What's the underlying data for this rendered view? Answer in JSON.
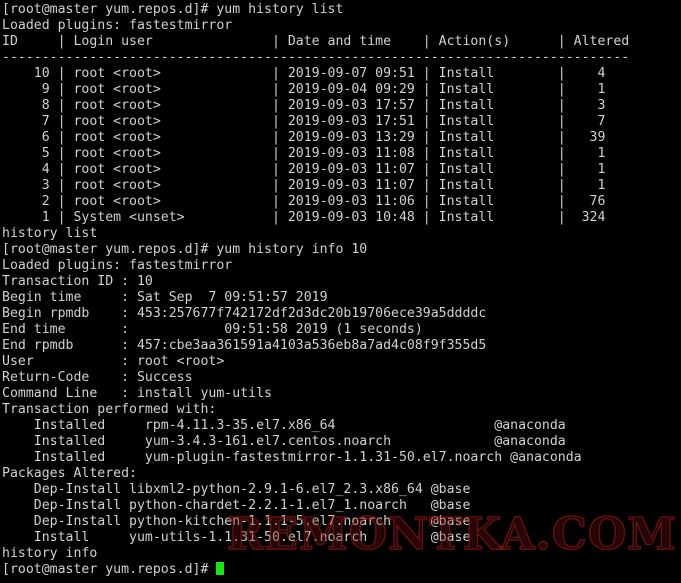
{
  "terminal": {
    "background_color": "#000000",
    "text_color": "#cfd2cd",
    "cursor_color": "#12e712",
    "watermark_color": "#961a1a",
    "watermark": "REMONTKA.COM",
    "prompt": "[root@master yum.repos.d]#",
    "lines": [
      "[root@master yum.repos.d]# yum history list",
      "Loaded plugins: fastestmirror",
      "ID     | Login user               | Date and time    | Action(s)      | Altered",
      "-------------------------------------------------------------------------------",
      "    10 | root <root>              | 2019-09-07 09:51 | Install        |    4",
      "     9 | root <root>              | 2019-09-04 09:29 | Install        |    1",
      "     8 | root <root>              | 2019-09-03 17:57 | Install        |    3",
      "     7 | root <root>              | 2019-09-03 17:51 | Install        |    7",
      "     6 | root <root>              | 2019-09-03 13:29 | Install        |   39",
      "     5 | root <root>              | 2019-09-03 11:08 | Install        |    1",
      "     4 | root <root>              | 2019-09-03 11:07 | Install        |    1",
      "     3 | root <root>              | 2019-09-03 11:07 | Install        |    1",
      "     2 | root <root>              | 2019-09-03 11:06 | Install        |   76",
      "     1 | System <unset>           | 2019-09-03 10:48 | Install        |  324",
      "history list",
      "[root@master yum.repos.d]# yum history info 10",
      "Loaded plugins: fastestmirror",
      "Transaction ID : 10",
      "Begin time     : Sat Sep  7 09:51:57 2019",
      "Begin rpmdb    : 453:257677f742172df2d3dc20b19706ece39a5ddddc",
      "End time       :            09:51:58 2019 (1 seconds)",
      "End rpmdb      : 457:cbe3aa361591a4103a536eb8a7ad4c08f9f355d5",
      "User           : root <root>",
      "Return-Code    : Success",
      "Command Line   : install yum-utils",
      "Transaction performed with:",
      "    Installed     rpm-4.11.3-35.el7.x86_64                    @anaconda",
      "    Installed     yum-3.4.3-161.el7.centos.noarch             @anaconda",
      "    Installed     yum-plugin-fastestmirror-1.1.31-50.el7.noarch @anaconda",
      "Packages Altered:",
      "    Dep-Install libxml2-python-2.9.1-6.el7_2.3.x86_64 @base",
      "    Dep-Install python-chardet-2.2.1-1.el7_1.noarch   @base",
      "    Dep-Install python-kitchen-1.1.1-5.el7.noarch     @base",
      "    Install     yum-utils-1.1.31-50.el7.noarch        @base",
      "history info",
      "[root@master yum.repos.d]# "
    ],
    "history_table": {
      "columns": [
        "ID",
        "Login user",
        "Date and time",
        "Action(s)",
        "Altered"
      ],
      "rows": [
        {
          "id": "10",
          "login_user": "root <root>",
          "datetime": "2019-09-07 09:51",
          "action": "Install",
          "altered": "4"
        },
        {
          "id": "9",
          "login_user": "root <root>",
          "datetime": "2019-09-04 09:29",
          "action": "Install",
          "altered": "1"
        },
        {
          "id": "8",
          "login_user": "root <root>",
          "datetime": "2019-09-03 17:57",
          "action": "Install",
          "altered": "3"
        },
        {
          "id": "7",
          "login_user": "root <root>",
          "datetime": "2019-09-03 17:51",
          "action": "Install",
          "altered": "7"
        },
        {
          "id": "6",
          "login_user": "root <root>",
          "datetime": "2019-09-03 13:29",
          "action": "Install",
          "altered": "39"
        },
        {
          "id": "5",
          "login_user": "root <root>",
          "datetime": "2019-09-03 11:08",
          "action": "Install",
          "altered": "1"
        },
        {
          "id": "4",
          "login_user": "root <root>",
          "datetime": "2019-09-03 11:07",
          "action": "Install",
          "altered": "1"
        },
        {
          "id": "3",
          "login_user": "root <root>",
          "datetime": "2019-09-03 11:07",
          "action": "Install",
          "altered": "1"
        },
        {
          "id": "2",
          "login_user": "root <root>",
          "datetime": "2019-09-03 11:06",
          "action": "Install",
          "altered": "76"
        },
        {
          "id": "1",
          "login_user": "System <unset>",
          "datetime": "2019-09-03 10:48",
          "action": "Install",
          "altered": "324"
        }
      ]
    },
    "transaction_info": {
      "transaction_id": "10",
      "begin_time": "Sat Sep  7 09:51:57 2019",
      "begin_rpmdb": "453:257677f742172df2d3dc20b19706ece39a5ddddc",
      "end_time": "           09:51:58 2019 (1 seconds)",
      "end_rpmdb": "457:cbe3aa361591a4103a536eb8a7ad4c08f9f355d5",
      "user": "root <root>",
      "return_code": "Success",
      "command_line": "install yum-utils",
      "performed_with": [
        {
          "state": "Installed",
          "package": "rpm-4.11.3-35.el7.x86_64",
          "repo": "@anaconda"
        },
        {
          "state": "Installed",
          "package": "yum-3.4.3-161.el7.centos.noarch",
          "repo": "@anaconda"
        },
        {
          "state": "Installed",
          "package": "yum-plugin-fastestmirror-1.1.31-50.el7.noarch",
          "repo": "@anaconda"
        }
      ],
      "packages_altered": [
        {
          "state": "Dep-Install",
          "package": "libxml2-python-2.9.1-6.el7_2.3.x86_64",
          "repo": "@base"
        },
        {
          "state": "Dep-Install",
          "package": "python-chardet-2.2.1-1.el7_1.noarch",
          "repo": "@base"
        },
        {
          "state": "Dep-Install",
          "package": "python-kitchen-1.1.1-5.el7.noarch",
          "repo": "@base"
        },
        {
          "state": "Install",
          "package": "yum-utils-1.1.31-50.el7.noarch",
          "repo": "@base"
        }
      ]
    },
    "commands": [
      "yum history list",
      "yum history info 10"
    ]
  }
}
